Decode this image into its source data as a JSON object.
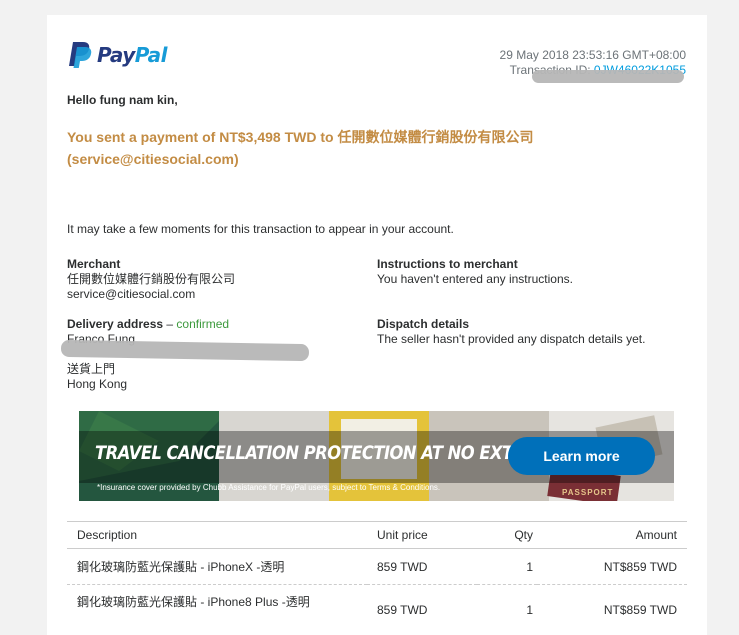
{
  "header": {
    "logo_text_pay": "Pay",
    "logo_text_pal": "Pal",
    "date": "29 May 2018 23:53:16 GMT+08:00",
    "transaction_label": "Transaction ID:",
    "transaction_id_partial": "0JW46022K1055"
  },
  "greeting": "Hello fung nam kin,",
  "headline": {
    "line1": "You sent a payment of NT$3,498 TWD to 任開數位媒體行銷股份有限公司",
    "line2": "(service@citiesocial.com)"
  },
  "note": "It may take a few moments for this transaction to appear in your account.",
  "merchant": {
    "label": "Merchant",
    "name": "任開數位媒體行銷股份有限公司",
    "email": "service@citiesocial.com"
  },
  "instructions": {
    "label": "Instructions to merchant",
    "text": "You haven't entered any instructions."
  },
  "delivery": {
    "label": "Delivery address",
    "separator": " – ",
    "status": "confirmed",
    "name": "Franco Fung",
    "line3": "送貨上門",
    "line4": "Hong Kong"
  },
  "dispatch": {
    "label": "Dispatch details",
    "text": "The seller hasn't provided any dispatch details yet."
  },
  "banner": {
    "title": "TRAVEL CANCELLATION PROTECTION AT NO EXTRA FEES*",
    "fine_print": "*Insurance cover provided by Chubb Assistance for PayPal users, subject to Terms & Conditions.",
    "button_label": "Learn more",
    "passport_text": "PASSPORT",
    "button_color": "#0070ba"
  },
  "table": {
    "headers": {
      "description": "Description",
      "unit_price": "Unit price",
      "qty": "Qty",
      "amount": "Amount"
    },
    "rows": [
      {
        "description": "鋼化玻璃防藍光保護貼 - iPhoneX -透明",
        "unit_price": "859 TWD",
        "qty": "1",
        "amount": "NT$859 TWD"
      },
      {
        "description": "鋼化玻璃防藍光保護貼 - iPhone8 Plus -透明",
        "unit_price": "859 TWD",
        "qty": "1",
        "amount": "NT$859 TWD"
      }
    ]
  },
  "colors": {
    "headline": "#c38c44",
    "link": "#009cde",
    "confirmed": "#3d9a3d",
    "paypal_dark": "#253b80",
    "paypal_light": "#179bd7"
  }
}
